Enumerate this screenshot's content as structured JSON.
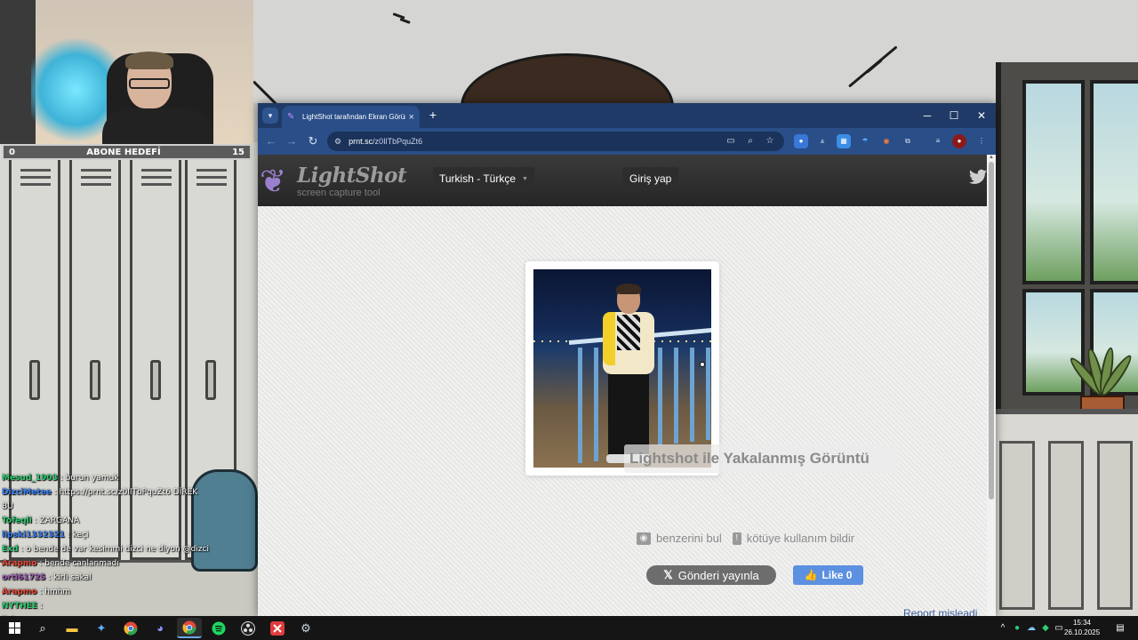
{
  "stream": {
    "goal": {
      "left_value": "0",
      "label": "ABONE HEDEFİ",
      "right_value": "15"
    },
    "chat": [
      {
        "user": "Mesud_1903",
        "message": "burun yamuk",
        "color": "#2ecc71"
      },
      {
        "user": "DizciMetee",
        "message": "https://prnt.sc/z0IlTbPquZt6 DİREK",
        "color": "#3b82f6"
      },
      {
        "user": "",
        "message": "BU",
        "color": "#ffffff"
      },
      {
        "user": "Tofeqli",
        "message": "ZARGANA",
        "color": "#2ecc71"
      },
      {
        "user": "lipski1332321",
        "message": "keçi",
        "color": "#3b82f6"
      },
      {
        "user": "Exd",
        "message": "o bende de var kesimmi dizci ne diyon @dizci",
        "color": "#2ecc71"
      },
      {
        "user": "Arapmo",
        "message": "bende canlanmadı",
        "color": "#e74c3c"
      },
      {
        "user": "orti61725",
        "message": "kirli sakal",
        "color": "#9b59b6"
      },
      {
        "user": "Arapmo",
        "message": "hmhm",
        "color": "#e74c3c"
      },
      {
        "user": "NYTHEE",
        "message": "",
        "color": "#2ecc71"
      },
      {
        "user": "Tahqu",
        "message": "",
        "color": "#2ecc71"
      }
    ]
  },
  "browser": {
    "tab_title": "LightShot tarafından Ekran Görüntüsü",
    "tab_close": "×",
    "new_tab": "+",
    "window_controls": {
      "minimize": "─",
      "maximize": "☐",
      "close": "✕"
    },
    "url_host": "prnt.sc",
    "url_path": "/z0IlTbPquZt6",
    "nav": {
      "back": "←",
      "forward": "→",
      "reload": "↻"
    }
  },
  "lightshot": {
    "logo_name": "LightShot",
    "logo_tagline": "screen capture tool",
    "language": "Turkish - Türkçe",
    "login": "Giriş yap",
    "caption": "Lightshot ile Yakalanmış Görüntü",
    "find_similar": "benzerini bul",
    "report_abuse": "kötüye kullanım bildir",
    "tweet_label": "Gönderi yayınla",
    "like_label": "Like 0",
    "report_misleading": "Report misleadi"
  },
  "taskbar": {
    "time": "15:34",
    "date": "26.10.2025",
    "items": [
      "windows-icon",
      "search-icon",
      "file-explorer-icon",
      "copilot-icon",
      "chrome-icon",
      "discord-icon",
      "chrome-icon",
      "spotify-icon",
      "obs-icon",
      "xmind-icon",
      "steam-icon"
    ]
  },
  "colors": {
    "titlebar": "#1f3a66",
    "toolbar": "#2a4e88",
    "like": "#5c90e0",
    "link": "#3c5f9c"
  }
}
